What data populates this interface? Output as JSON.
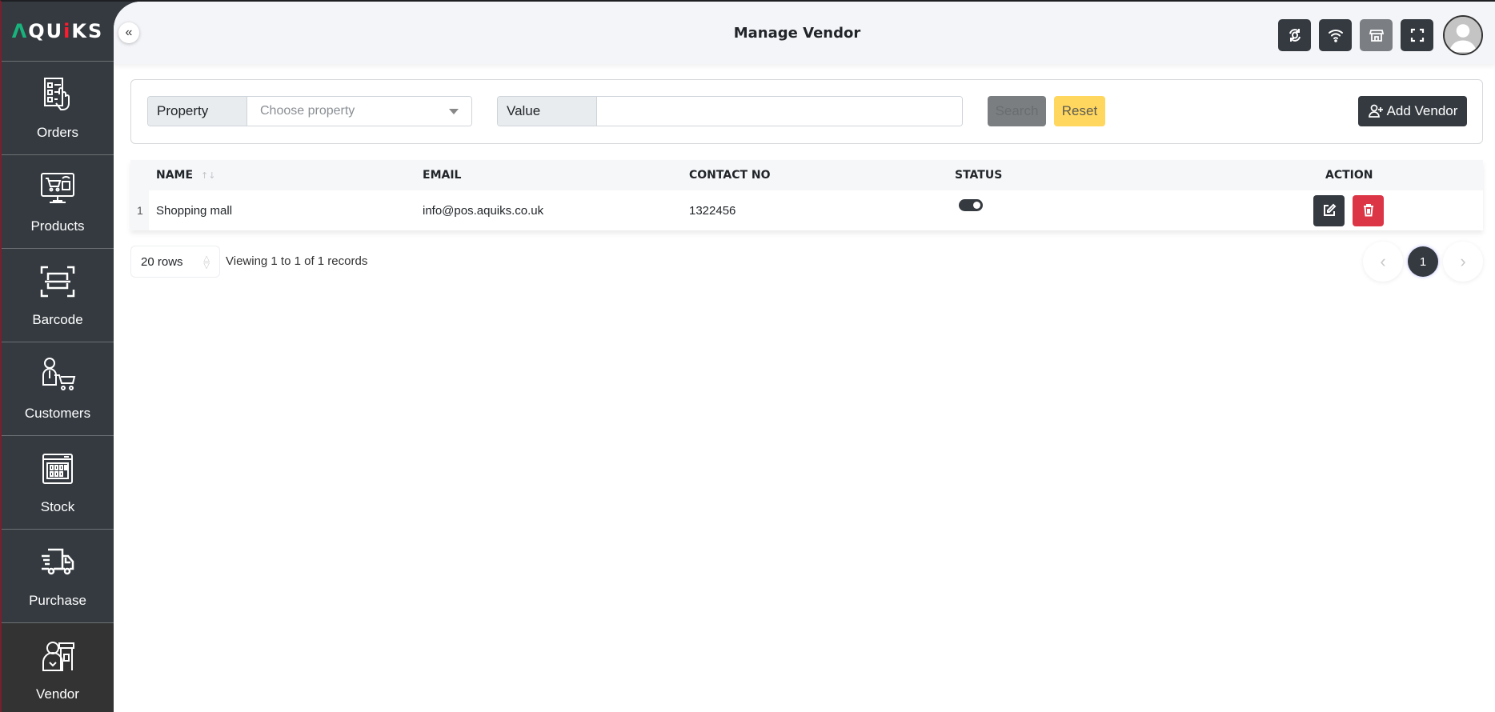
{
  "app": {
    "logo": {
      "text_start": "Λ",
      "text_q": "QU",
      "text_i": "i",
      "text_end": "KS"
    },
    "accent_color": "#343a40"
  },
  "sidebar": {
    "items": [
      {
        "label": "Orders",
        "icon": "orders-checklist-icon"
      },
      {
        "label": "Products",
        "icon": "products-monitor-cart-icon"
      },
      {
        "label": "Barcode",
        "icon": "barcode-scan-icon"
      },
      {
        "label": "Customers",
        "icon": "customer-cart-icon"
      },
      {
        "label": "Stock",
        "icon": "stock-grid-icon"
      },
      {
        "label": "Purchase",
        "icon": "delivery-truck-icon"
      },
      {
        "label": "Vendor",
        "icon": "vendor-store-icon",
        "active": true
      }
    ]
  },
  "header": {
    "collapse_icon": "«",
    "title": "Manage Vendor",
    "actions": [
      {
        "name": "sync",
        "icon": "sync-icon"
      },
      {
        "name": "wifi",
        "icon": "wifi-icon"
      },
      {
        "name": "store",
        "icon": "store-icon"
      },
      {
        "name": "fullscreen",
        "icon": "fullscreen-icon"
      }
    ]
  },
  "filter": {
    "property_label": "Property",
    "property_placeholder": "Choose property",
    "value_label": "Value",
    "value_input": "",
    "search_label": "Search",
    "reset_label": "Reset",
    "add_label": "Add Vendor"
  },
  "table": {
    "columns": [
      "NAME",
      "EMAIL",
      "CONTACT NO",
      "STATUS",
      "ACTION"
    ],
    "sort_icon": "↑↓",
    "rows": [
      {
        "index": "1",
        "name": "Shopping mall",
        "email": "info@pos.aquiks.co.uk",
        "contact": "1322456",
        "status_active": true
      }
    ]
  },
  "footer": {
    "rows_per_page": "20 rows",
    "viewing_text": "Viewing 1 to 1 of 1 records",
    "prev": "‹",
    "current_page": "1",
    "next": "›"
  }
}
